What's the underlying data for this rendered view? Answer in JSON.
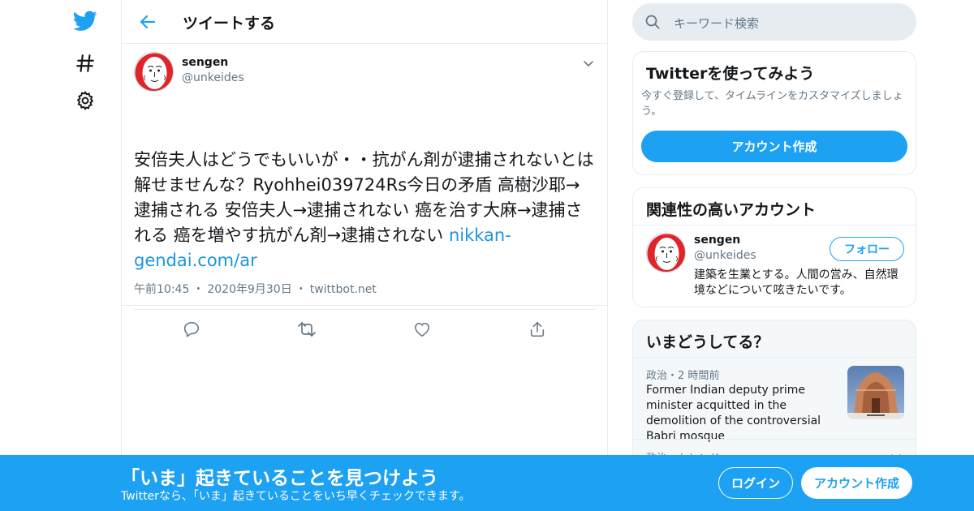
{
  "colors": {
    "brand": "#1da1f2",
    "link": "#1b95e0",
    "text_primary": "#14171a",
    "text_secondary": "#657786",
    "border": "#e6ecf0",
    "avatar_red": "#e0242a"
  },
  "nav": {
    "items": [
      {
        "icon": "twitter-bird-icon"
      },
      {
        "icon": "hashtag-icon"
      },
      {
        "icon": "gear-icon"
      }
    ]
  },
  "header": {
    "title": "ツイートする",
    "back_icon": "back-arrow-icon"
  },
  "tweet": {
    "author_name": "sengen",
    "author_handle": "@unkeides",
    "text": "安倍夫人はどうでもいいが・・抗がん剤が逮捕されないとは解せませんな？Ryohhei039724Rs今日の矛盾 高樹沙耶→逮捕される 安倍夫人→逮捕されない 癌を治す大麻→逮捕される 癌を増やす抗がん剤→逮捕されない ",
    "link_text": "nikkan-gendai.com/ar",
    "time": "午前10:45",
    "date": "2020年9月30日",
    "source": "twittbot.net",
    "dot": "・",
    "actions": [
      {
        "icon": "reply-icon"
      },
      {
        "icon": "retweet-icon"
      },
      {
        "icon": "like-icon"
      },
      {
        "icon": "share-icon"
      }
    ]
  },
  "search": {
    "placeholder": "キーワード検索"
  },
  "signup_card": {
    "title": "Twitterを使ってみよう",
    "description": "今すぐ登録して、タイムラインをカスタマイズしましょう。",
    "button": "アカウント作成"
  },
  "related_card": {
    "title": "関連性の高いアカウント",
    "name": "sengen",
    "handle": "@unkeides",
    "follow_label": "フォロー",
    "bio": "建築を生業とする。人間の営み、自然環境などについて呟きたいです。"
  },
  "trends_card": {
    "title": "いまどうしてる？",
    "trend1": {
      "meta": "政治・2 時間前",
      "headline": "Former Indian deputy prime minister acquitted in the demolition of the controversial Babri mosque"
    },
    "trend2": {
      "meta": "政治・トレンド"
    }
  },
  "banner": {
    "title": "「いま」起きていることを見つけよう",
    "subtitle": "Twitterなら、「いま」起きていることをいち早くチェックできます。",
    "login": "ログイン",
    "signup": "アカウント作成"
  }
}
